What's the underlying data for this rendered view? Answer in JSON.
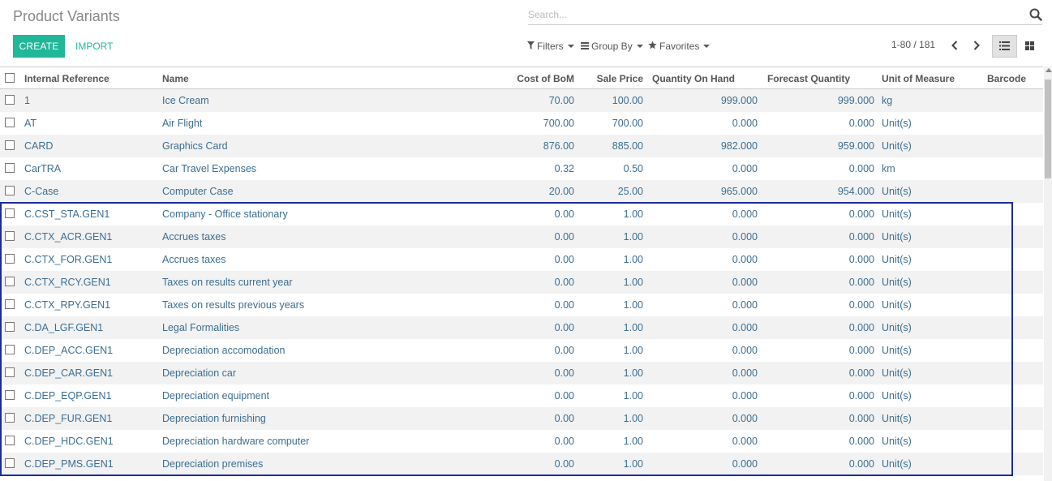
{
  "page": {
    "title": "Product Variants"
  },
  "toolbar": {
    "create_label": "CREATE",
    "import_label": "IMPORT"
  },
  "search": {
    "placeholder": "Search..."
  },
  "filters": {
    "filters_label": "Filters",
    "groupby_label": "Group By",
    "favorites_label": "Favorites"
  },
  "pager": {
    "value": "1-80 / 181"
  },
  "columns": {
    "internal_reference": "Internal Reference",
    "name": "Name",
    "cost_of_bom": "Cost of BoM",
    "sale_price": "Sale Price",
    "qty_on_hand": "Quantity On Hand",
    "forecast_qty": "Forecast Quantity",
    "uom": "Unit of Measure",
    "barcode": "Barcode"
  },
  "rows": [
    {
      "ref": "1",
      "name": "Ice Cream",
      "bom": "70.00",
      "sale": "100.00",
      "qoh": "999.000",
      "fq": "999.000",
      "uom": "kg"
    },
    {
      "ref": "AT",
      "name": "Air Flight",
      "bom": "700.00",
      "sale": "700.00",
      "qoh": "0.000",
      "fq": "0.000",
      "uom": "Unit(s)"
    },
    {
      "ref": "CARD",
      "name": "Graphics Card",
      "bom": "876.00",
      "sale": "885.00",
      "qoh": "982.000",
      "fq": "959.000",
      "uom": "Unit(s)"
    },
    {
      "ref": "CarTRA",
      "name": "Car Travel Expenses",
      "bom": "0.32",
      "sale": "0.50",
      "qoh": "0.000",
      "fq": "0.000",
      "uom": "km"
    },
    {
      "ref": "C-Case",
      "name": "Computer Case",
      "bom": "20.00",
      "sale": "25.00",
      "qoh": "965.000",
      "fq": "954.000",
      "uom": "Unit(s)"
    },
    {
      "ref": "C.CST_STA.GEN1",
      "name": "Company - Office stationary",
      "bom": "0.00",
      "sale": "1.00",
      "qoh": "0.000",
      "fq": "0.000",
      "uom": "Unit(s)"
    },
    {
      "ref": "C.CTX_ACR.GEN1",
      "name": "Accrues taxes",
      "bom": "0.00",
      "sale": "1.00",
      "qoh": "0.000",
      "fq": "0.000",
      "uom": "Unit(s)"
    },
    {
      "ref": "C.CTX_FOR.GEN1",
      "name": "Accrues taxes",
      "bom": "0.00",
      "sale": "1.00",
      "qoh": "0.000",
      "fq": "0.000",
      "uom": "Unit(s)"
    },
    {
      "ref": "C.CTX_RCY.GEN1",
      "name": "Taxes on results current year",
      "bom": "0.00",
      "sale": "1.00",
      "qoh": "0.000",
      "fq": "0.000",
      "uom": "Unit(s)"
    },
    {
      "ref": "C.CTX_RPY.GEN1",
      "name": "Taxes on results previous years",
      "bom": "0.00",
      "sale": "1.00",
      "qoh": "0.000",
      "fq": "0.000",
      "uom": "Unit(s)"
    },
    {
      "ref": "C.DA_LGF.GEN1",
      "name": "Legal Formalities",
      "bom": "0.00",
      "sale": "1.00",
      "qoh": "0.000",
      "fq": "0.000",
      "uom": "Unit(s)"
    },
    {
      "ref": "C.DEP_ACC.GEN1",
      "name": "Depreciation accomodation",
      "bom": "0.00",
      "sale": "1.00",
      "qoh": "0.000",
      "fq": "0.000",
      "uom": "Unit(s)"
    },
    {
      "ref": "C.DEP_CAR.GEN1",
      "name": "Depreciation car",
      "bom": "0.00",
      "sale": "1.00",
      "qoh": "0.000",
      "fq": "0.000",
      "uom": "Unit(s)"
    },
    {
      "ref": "C.DEP_EQP.GEN1",
      "name": "Depreciation equipment",
      "bom": "0.00",
      "sale": "1.00",
      "qoh": "0.000",
      "fq": "0.000",
      "uom": "Unit(s)"
    },
    {
      "ref": "C.DEP_FUR.GEN1",
      "name": "Depreciation furnishing",
      "bom": "0.00",
      "sale": "1.00",
      "qoh": "0.000",
      "fq": "0.000",
      "uom": "Unit(s)"
    },
    {
      "ref": "C.DEP_HDC.GEN1",
      "name": "Depreciation hardware computer",
      "bom": "0.00",
      "sale": "1.00",
      "qoh": "0.000",
      "fq": "0.000",
      "uom": "Unit(s)"
    },
    {
      "ref": "C.DEP_PMS.GEN1",
      "name": "Depreciation premises",
      "bom": "0.00",
      "sale": "1.00",
      "qoh": "0.000",
      "fq": "0.000",
      "uom": "Unit(s)"
    }
  ],
  "colors": {
    "accent": "#21b799",
    "link": "#3b6e94",
    "highlight": "#1c2b9a"
  }
}
